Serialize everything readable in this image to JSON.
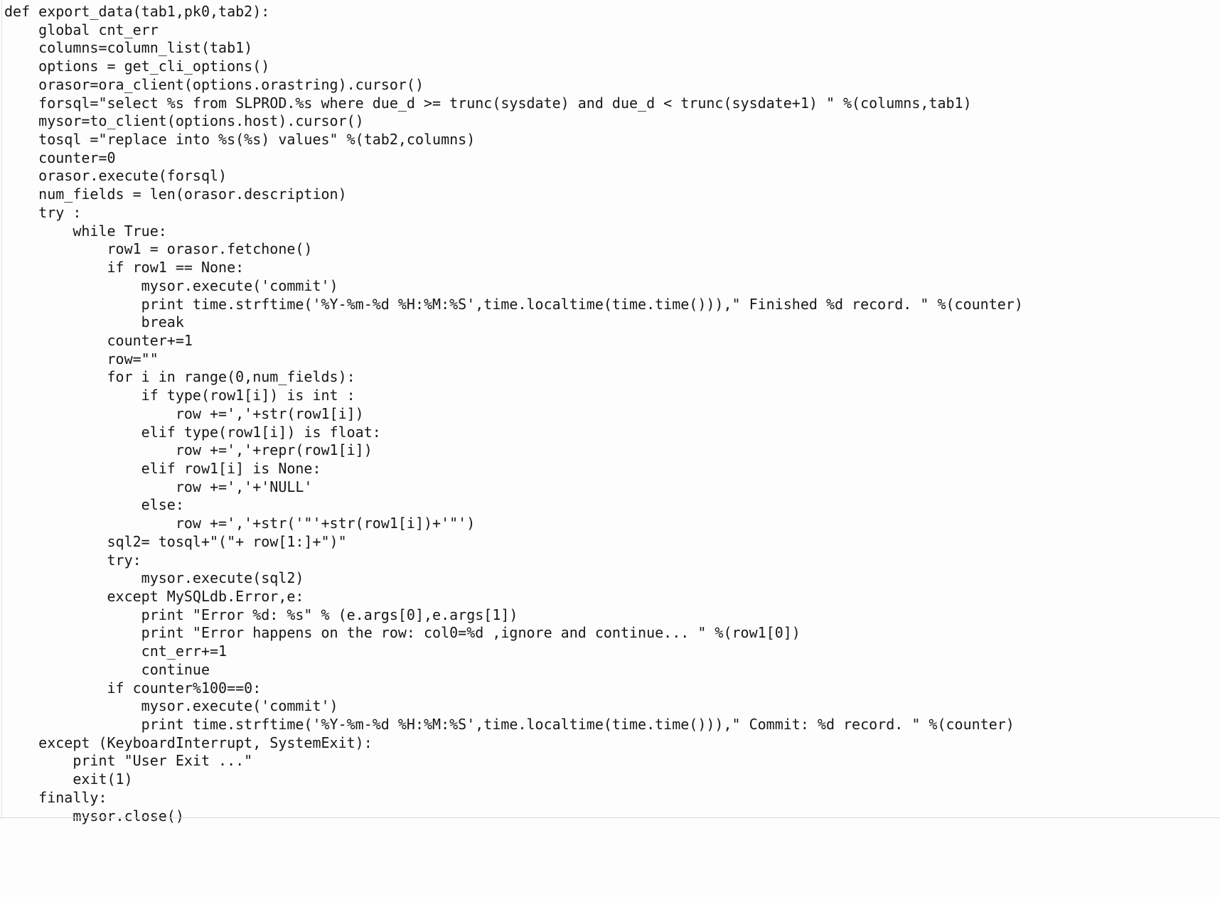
{
  "document": {
    "kind": "source-code-listing",
    "language": "Python",
    "function_name": "export_data",
    "background_color": "#fdfdfd",
    "text_color": "#171717",
    "font_style": "monospace"
  },
  "code": {
    "lines": [
      "def export_data(tab1,pk0,tab2):",
      "    global cnt_err",
      "    columns=column_list(tab1)",
      "    options = get_cli_options()",
      "    orasor=ora_client(options.orastring).cursor()",
      "    forsql=\"select %s from SLPROD.%s where due_d >= trunc(sysdate) and due_d < trunc(sysdate+1) \" %(columns,tab1)",
      "    mysor=to_client(options.host).cursor()",
      "    tosql =\"replace into %s(%s) values\" %(tab2,columns)",
      "    counter=0",
      "    orasor.execute(forsql)",
      "    num_fields = len(orasor.description)",
      "    try :",
      "        while True:",
      "            row1 = orasor.fetchone()",
      "            if row1 == None:",
      "                mysor.execute('commit')",
      "                print time.strftime('%Y-%m-%d %H:%M:%S',time.localtime(time.time())),\" Finished %d record. \" %(counter)",
      "                break",
      "            counter+=1",
      "            row=\"\"",
      "            for i in range(0,num_fields):",
      "                if type(row1[i]) is int :",
      "                    row +=','+str(row1[i])",
      "                elif type(row1[i]) is float:",
      "                    row +=','+repr(row1[i])",
      "                elif row1[i] is None:",
      "                    row +=','+'NULL'",
      "                else:",
      "                    row +=','+str('\"'+str(row1[i])+'\"')",
      "            sql2= tosql+\"(\"+ row[1:]+\")\"",
      "            try:",
      "                mysor.execute(sql2)",
      "            except MySQLdb.Error,e:",
      "                print \"Error %d: %s\" % (e.args[0],e.args[1])",
      "                print \"Error happens on the row: col0=%d ,ignore and continue... \" %(row1[0])",
      "                cnt_err+=1",
      "                continue",
      "            if counter%100==0:",
      "                mysor.execute('commit')",
      "                print time.strftime('%Y-%m-%d %H:%M:%S',time.localtime(time.time())),\" Commit: %d record. \" %(counter)",
      "    except (KeyboardInterrupt, SystemExit):",
      "        print \"User Exit ...\"",
      "        exit(1)",
      "    finally:",
      "        mysor.close()"
    ]
  }
}
